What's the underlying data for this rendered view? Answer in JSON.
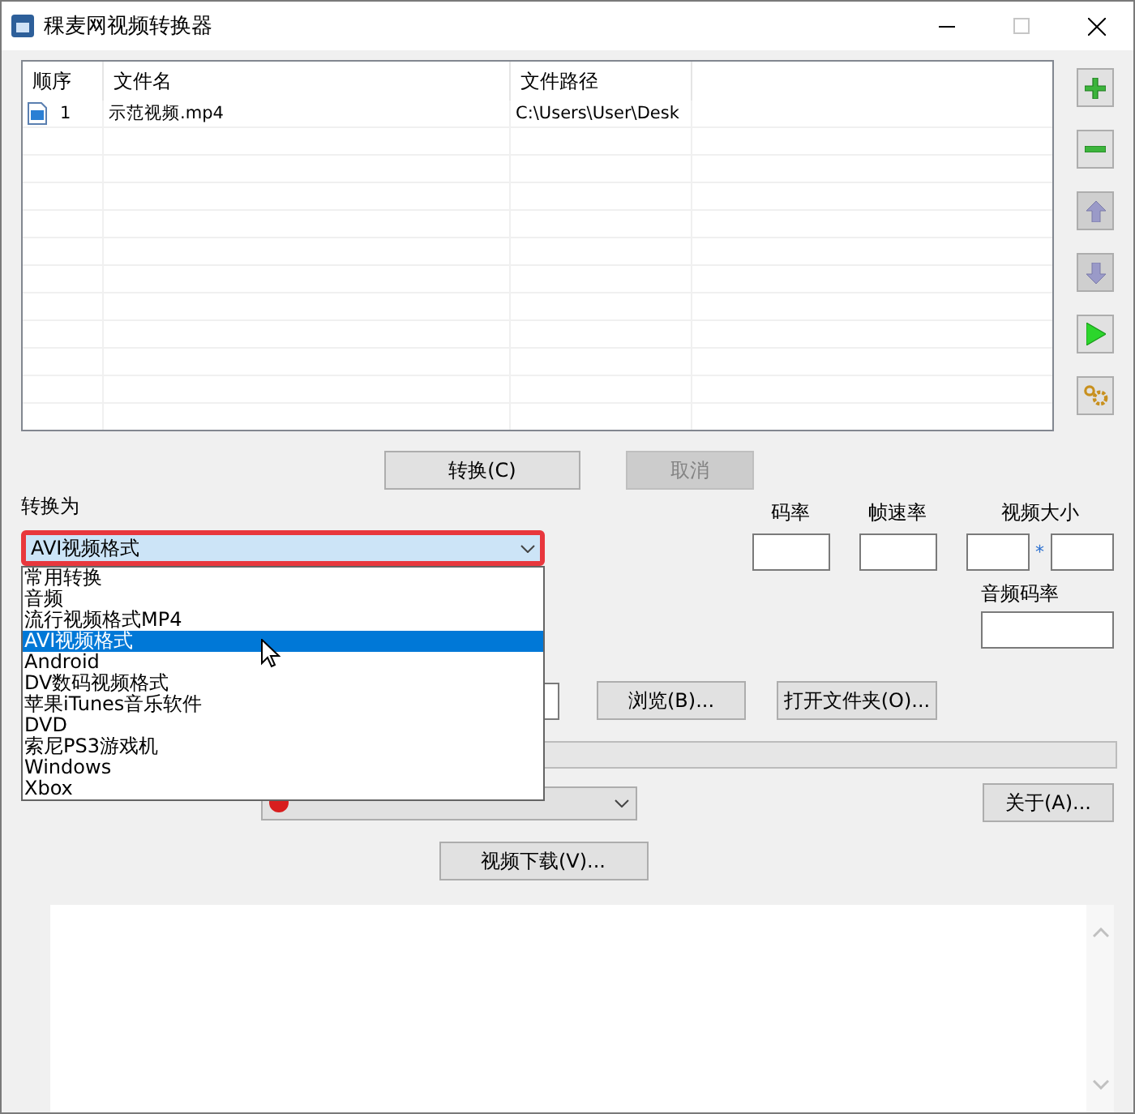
{
  "window": {
    "title": "稞麦网视频转换器"
  },
  "file_list": {
    "columns": [
      "顺序",
      "文件名",
      "文件路径"
    ],
    "rows": [
      {
        "index": "1",
        "name": "示范视频.mp4",
        "path": "C:\\Users\\User\\Desk"
      }
    ]
  },
  "side_tools": [
    {
      "kind": "add",
      "disabled": false
    },
    {
      "kind": "remove",
      "disabled": false
    },
    {
      "kind": "up",
      "disabled": true
    },
    {
      "kind": "down",
      "disabled": true
    },
    {
      "kind": "start",
      "disabled": false
    },
    {
      "kind": "settings",
      "disabled": false
    }
  ],
  "actions": [
    {
      "label": "转换(C)",
      "disabled": false
    },
    {
      "label": "取消",
      "disabled": true
    }
  ],
  "convert_to": {
    "label": "转换为",
    "value": "AVI视频格式",
    "expanded": true,
    "options": [
      {
        "label": "常用转换",
        "selected": false
      },
      {
        "label": "音频",
        "selected": false
      },
      {
        "label": "流行视频格式MP4",
        "selected": false
      },
      {
        "label": "AVI视频格式",
        "selected": true
      },
      {
        "label": "Android",
        "selected": false
      },
      {
        "label": "DV数码视频格式",
        "selected": false
      },
      {
        "label": "苹果iTunes音乐软件",
        "selected": false
      },
      {
        "label": "DVD",
        "selected": false
      },
      {
        "label": "索尼PS3游戏机",
        "selected": false
      },
      {
        "label": "Windows",
        "selected": false
      },
      {
        "label": "Xbox",
        "selected": false
      }
    ]
  },
  "settings": {
    "bitrate": "码率",
    "framerate": "帧速率",
    "video_size": "视频大小",
    "size_separator": "*",
    "audio_bitrate": "音频码率"
  },
  "output": {
    "browse": "浏览(B)...",
    "open_folder": "打开文件夹(O)..."
  },
  "progress": {
    "level": 0
  },
  "about": "关于(A)...",
  "download": "视频下载(V)..."
}
